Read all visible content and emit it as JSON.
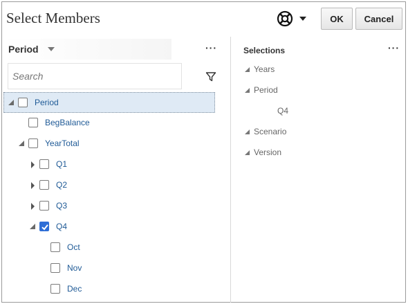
{
  "dialog": {
    "title": "Select Members",
    "help_icon": "lifebuoy-icon",
    "ok_label": "OK",
    "cancel_label": "Cancel"
  },
  "left": {
    "dimension_label": "Period",
    "more_label": "···",
    "search_placeholder": "Search",
    "filter_icon": "filter-icon",
    "tree": [
      {
        "label": "Period",
        "level": 0,
        "toggle": "expanded",
        "checked": false,
        "selected": true
      },
      {
        "label": "BegBalance",
        "level": 1,
        "toggle": "none",
        "checked": false
      },
      {
        "label": "YearTotal",
        "level": 1,
        "toggle": "expanded",
        "checked": false
      },
      {
        "label": "Q1",
        "level": 2,
        "toggle": "collapsed",
        "checked": false
      },
      {
        "label": "Q2",
        "level": 2,
        "toggle": "collapsed",
        "checked": false
      },
      {
        "label": "Q3",
        "level": 2,
        "toggle": "collapsed",
        "checked": false
      },
      {
        "label": "Q4",
        "level": 2,
        "toggle": "expanded",
        "checked": true
      },
      {
        "label": "Oct",
        "level": 3,
        "toggle": "none",
        "checked": false
      },
      {
        "label": "Nov",
        "level": 3,
        "toggle": "none",
        "checked": false
      },
      {
        "label": "Dec",
        "level": 3,
        "toggle": "none",
        "checked": false
      }
    ]
  },
  "right": {
    "title": "Selections",
    "more_label": "···",
    "items": [
      {
        "label": "Years",
        "level": 0,
        "toggle": "expanded"
      },
      {
        "label": "Period",
        "level": 0,
        "toggle": "expanded"
      },
      {
        "label": "Q4",
        "level": 1,
        "toggle": "none"
      },
      {
        "label": "Scenario",
        "level": 0,
        "toggle": "expanded"
      },
      {
        "label": "Version",
        "level": 0,
        "toggle": "expanded"
      }
    ]
  },
  "colors": {
    "accent": "#2e6ed6",
    "member_link": "#1f5a96",
    "selected_row": "#dfeaf5"
  }
}
